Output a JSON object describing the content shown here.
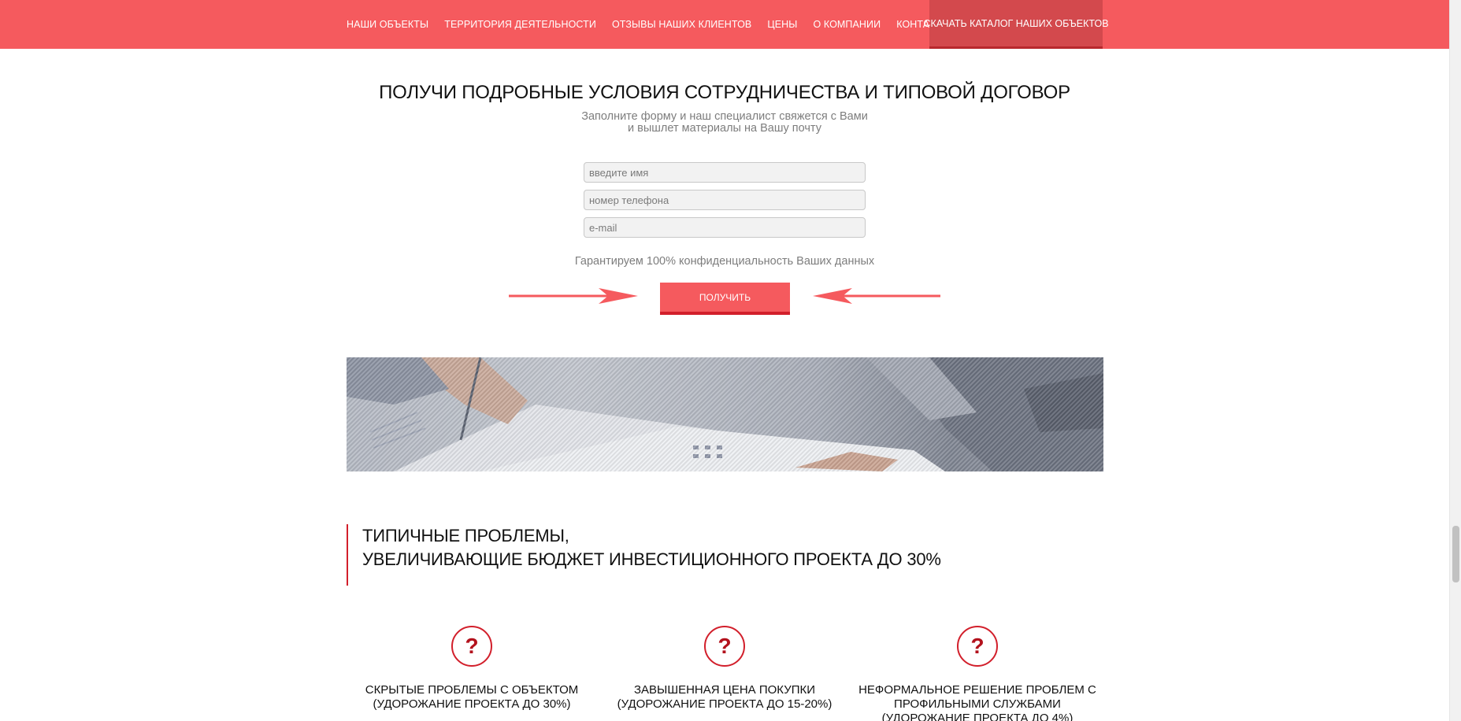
{
  "nav": {
    "items": [
      "НАШИ ОБЪЕКТЫ",
      "ТЕРРИТОРИЯ ДЕЯТЕЛЬНОСТИ",
      "ОТЗЫВЫ НАШИХ КЛИЕНТОВ",
      "ЦЕНЫ",
      "О КОМПАНИИ",
      "КОНТАКТЫ"
    ],
    "cta": "СКАЧАТЬ КАТАЛОГ НАШИХ ОБЪЕКТОВ"
  },
  "form": {
    "title": "ПОЛУЧИ ПОДРОБНЫЕ УСЛОВИЯ СОТРУДНИЧЕСТВА И ТИПОВОЙ ДОГОВОР",
    "subtitle_line1": "Заполните форму и наш специалист свяжется с Вами",
    "subtitle_line2": "и вышлет материалы на Вашу почту",
    "fields": {
      "name_placeholder": "введите имя",
      "phone_placeholder": "номер телефона",
      "email_placeholder": "e-mail"
    },
    "privacy": "Гарантируем 100% конфиденциальность Ваших данных",
    "submit_label": "ПОЛУЧИТЬ"
  },
  "problems": {
    "heading_line1": "ТИПИЧНЫЕ ПРОБЛЕМЫ,",
    "heading_line2": "УВЕЛИЧИВАЮЩИЕ БЮДЖЕТ ИНВЕСТИЦИОННОГО ПРОЕКТА ДО 30%",
    "icon_glyph": "?",
    "items": [
      {
        "line1": "СКРЫТЫЕ ПРОБЛЕМЫ С ОБЪЕКТОМ",
        "line2": "(УДОРОЖАНИЕ ПРОЕКТА ДО 30%)",
        "line3": ""
      },
      {
        "line1": "ЗАВЫШЕННАЯ ЦЕНА ПОКУПКИ",
        "line2": "(УДОРОЖАНИЕ ПРОЕКТА ДО 15-20%)",
        "line3": ""
      },
      {
        "line1": "НЕФОРМАЛЬНОЕ РЕШЕНИЕ ПРОБЛЕМ С",
        "line2": "ПРОФИЛЬНЫМИ СЛУЖБАМИ",
        "line3": "(УДОРОЖАНИЕ ПРОЕКТА ДО 4%)"
      }
    ]
  },
  "colors": {
    "brand": "#f55a5e",
    "brand_dark": "#d3494d",
    "accent_red": "#d21f2b"
  }
}
